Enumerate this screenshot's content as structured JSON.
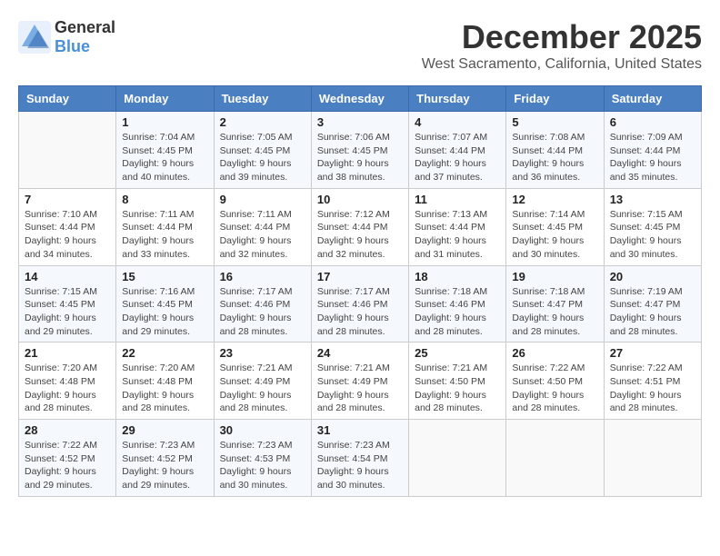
{
  "header": {
    "logo_general": "General",
    "logo_blue": "Blue",
    "title": "December 2025",
    "subtitle": "West Sacramento, California, United States"
  },
  "days_of_week": [
    "Sunday",
    "Monday",
    "Tuesday",
    "Wednesday",
    "Thursday",
    "Friday",
    "Saturday"
  ],
  "weeks": [
    [
      {
        "day": "",
        "info": ""
      },
      {
        "day": "1",
        "info": "Sunrise: 7:04 AM\nSunset: 4:45 PM\nDaylight: 9 hours\nand 40 minutes."
      },
      {
        "day": "2",
        "info": "Sunrise: 7:05 AM\nSunset: 4:45 PM\nDaylight: 9 hours\nand 39 minutes."
      },
      {
        "day": "3",
        "info": "Sunrise: 7:06 AM\nSunset: 4:45 PM\nDaylight: 9 hours\nand 38 minutes."
      },
      {
        "day": "4",
        "info": "Sunrise: 7:07 AM\nSunset: 4:44 PM\nDaylight: 9 hours\nand 37 minutes."
      },
      {
        "day": "5",
        "info": "Sunrise: 7:08 AM\nSunset: 4:44 PM\nDaylight: 9 hours\nand 36 minutes."
      },
      {
        "day": "6",
        "info": "Sunrise: 7:09 AM\nSunset: 4:44 PM\nDaylight: 9 hours\nand 35 minutes."
      }
    ],
    [
      {
        "day": "7",
        "info": "Sunrise: 7:10 AM\nSunset: 4:44 PM\nDaylight: 9 hours\nand 34 minutes."
      },
      {
        "day": "8",
        "info": "Sunrise: 7:11 AM\nSunset: 4:44 PM\nDaylight: 9 hours\nand 33 minutes."
      },
      {
        "day": "9",
        "info": "Sunrise: 7:11 AM\nSunset: 4:44 PM\nDaylight: 9 hours\nand 32 minutes."
      },
      {
        "day": "10",
        "info": "Sunrise: 7:12 AM\nSunset: 4:44 PM\nDaylight: 9 hours\nand 32 minutes."
      },
      {
        "day": "11",
        "info": "Sunrise: 7:13 AM\nSunset: 4:44 PM\nDaylight: 9 hours\nand 31 minutes."
      },
      {
        "day": "12",
        "info": "Sunrise: 7:14 AM\nSunset: 4:45 PM\nDaylight: 9 hours\nand 30 minutes."
      },
      {
        "day": "13",
        "info": "Sunrise: 7:15 AM\nSunset: 4:45 PM\nDaylight: 9 hours\nand 30 minutes."
      }
    ],
    [
      {
        "day": "14",
        "info": "Sunrise: 7:15 AM\nSunset: 4:45 PM\nDaylight: 9 hours\nand 29 minutes."
      },
      {
        "day": "15",
        "info": "Sunrise: 7:16 AM\nSunset: 4:45 PM\nDaylight: 9 hours\nand 29 minutes."
      },
      {
        "day": "16",
        "info": "Sunrise: 7:17 AM\nSunset: 4:46 PM\nDaylight: 9 hours\nand 28 minutes."
      },
      {
        "day": "17",
        "info": "Sunrise: 7:17 AM\nSunset: 4:46 PM\nDaylight: 9 hours\nand 28 minutes."
      },
      {
        "day": "18",
        "info": "Sunrise: 7:18 AM\nSunset: 4:46 PM\nDaylight: 9 hours\nand 28 minutes."
      },
      {
        "day": "19",
        "info": "Sunrise: 7:18 AM\nSunset: 4:47 PM\nDaylight: 9 hours\nand 28 minutes."
      },
      {
        "day": "20",
        "info": "Sunrise: 7:19 AM\nSunset: 4:47 PM\nDaylight: 9 hours\nand 28 minutes."
      }
    ],
    [
      {
        "day": "21",
        "info": "Sunrise: 7:20 AM\nSunset: 4:48 PM\nDaylight: 9 hours\nand 28 minutes."
      },
      {
        "day": "22",
        "info": "Sunrise: 7:20 AM\nSunset: 4:48 PM\nDaylight: 9 hours\nand 28 minutes."
      },
      {
        "day": "23",
        "info": "Sunrise: 7:21 AM\nSunset: 4:49 PM\nDaylight: 9 hours\nand 28 minutes."
      },
      {
        "day": "24",
        "info": "Sunrise: 7:21 AM\nSunset: 4:49 PM\nDaylight: 9 hours\nand 28 minutes."
      },
      {
        "day": "25",
        "info": "Sunrise: 7:21 AM\nSunset: 4:50 PM\nDaylight: 9 hours\nand 28 minutes."
      },
      {
        "day": "26",
        "info": "Sunrise: 7:22 AM\nSunset: 4:50 PM\nDaylight: 9 hours\nand 28 minutes."
      },
      {
        "day": "27",
        "info": "Sunrise: 7:22 AM\nSunset: 4:51 PM\nDaylight: 9 hours\nand 28 minutes."
      }
    ],
    [
      {
        "day": "28",
        "info": "Sunrise: 7:22 AM\nSunset: 4:52 PM\nDaylight: 9 hours\nand 29 minutes."
      },
      {
        "day": "29",
        "info": "Sunrise: 7:23 AM\nSunset: 4:52 PM\nDaylight: 9 hours\nand 29 minutes."
      },
      {
        "day": "30",
        "info": "Sunrise: 7:23 AM\nSunset: 4:53 PM\nDaylight: 9 hours\nand 30 minutes."
      },
      {
        "day": "31",
        "info": "Sunrise: 7:23 AM\nSunset: 4:54 PM\nDaylight: 9 hours\nand 30 minutes."
      },
      {
        "day": "",
        "info": ""
      },
      {
        "day": "",
        "info": ""
      },
      {
        "day": "",
        "info": ""
      }
    ]
  ]
}
